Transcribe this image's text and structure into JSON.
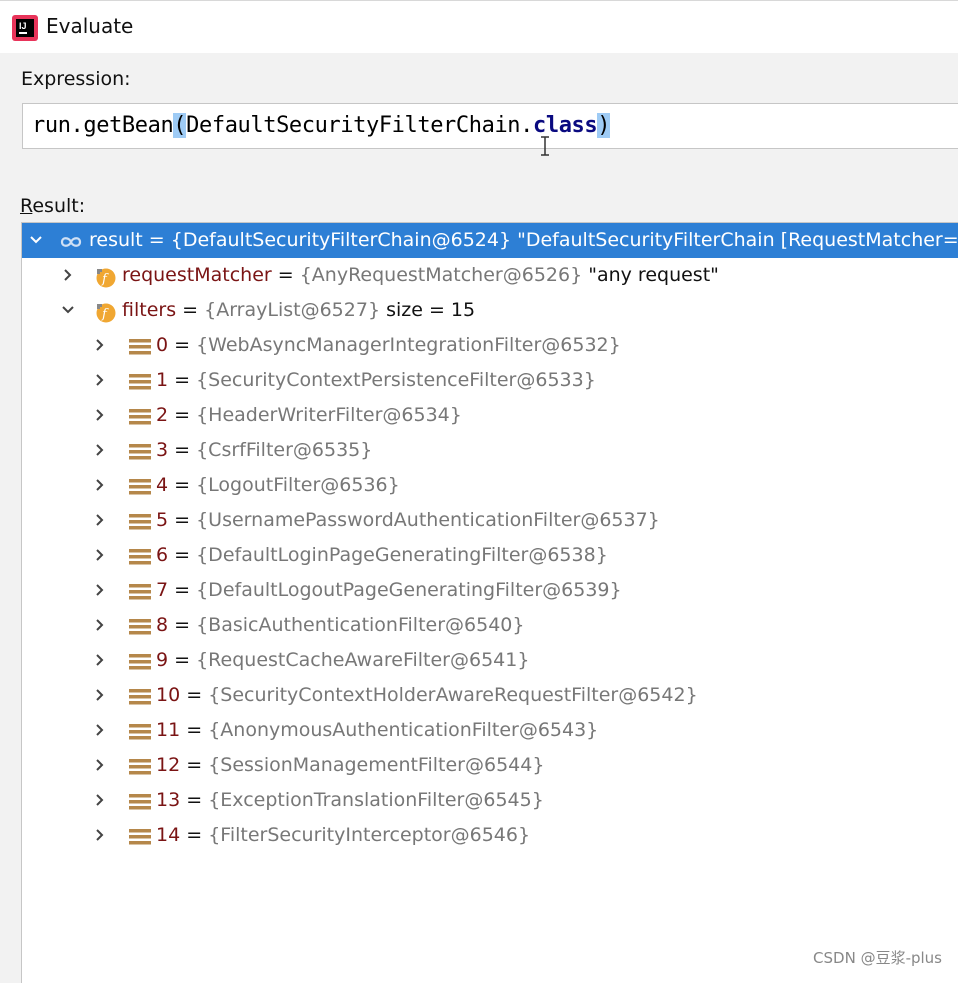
{
  "window": {
    "title": "Evaluate"
  },
  "expression": {
    "label": "Expression:",
    "code_before": "run.getBean",
    "open_paren": "(",
    "class_name": "DefaultSecurityFilterChain",
    "dot": ".",
    "keyword": "class",
    "close_paren": ")"
  },
  "result": {
    "label_u": "R",
    "label_rest": "esult:",
    "root": {
      "name": "result",
      "eq": " = ",
      "ref": "{DefaultSecurityFilterChain@6524}",
      "value": " \"DefaultSecurityFilterChain [RequestMatcher=a"
    },
    "fields": [
      {
        "name": "requestMatcher",
        "eq": " = ",
        "ref": "{AnyRequestMatcher@6526}",
        "value": " \"any request\""
      },
      {
        "name": "filters",
        "eq": " = ",
        "ref": "{ArrayList@6527}",
        "value": "  size = 15"
      }
    ],
    "items": [
      {
        "index": "0",
        "eq": " = ",
        "ref": "{WebAsyncManagerIntegrationFilter@6532}"
      },
      {
        "index": "1",
        "eq": " = ",
        "ref": "{SecurityContextPersistenceFilter@6533}"
      },
      {
        "index": "2",
        "eq": " = ",
        "ref": "{HeaderWriterFilter@6534}"
      },
      {
        "index": "3",
        "eq": " = ",
        "ref": "{CsrfFilter@6535}"
      },
      {
        "index": "4",
        "eq": " = ",
        "ref": "{LogoutFilter@6536}"
      },
      {
        "index": "5",
        "eq": " = ",
        "ref": "{UsernamePasswordAuthenticationFilter@6537}"
      },
      {
        "index": "6",
        "eq": " = ",
        "ref": "{DefaultLoginPageGeneratingFilter@6538}"
      },
      {
        "index": "7",
        "eq": " = ",
        "ref": "{DefaultLogoutPageGeneratingFilter@6539}"
      },
      {
        "index": "8",
        "eq": " = ",
        "ref": "{BasicAuthenticationFilter@6540}"
      },
      {
        "index": "9",
        "eq": " = ",
        "ref": "{RequestCacheAwareFilter@6541}"
      },
      {
        "index": "10",
        "eq": " = ",
        "ref": "{SecurityContextHolderAwareRequestFilter@6542}"
      },
      {
        "index": "11",
        "eq": " = ",
        "ref": "{AnonymousAuthenticationFilter@6543}"
      },
      {
        "index": "12",
        "eq": " = ",
        "ref": "{SessionManagementFilter@6544}"
      },
      {
        "index": "13",
        "eq": " = ",
        "ref": "{ExceptionTranslationFilter@6545}"
      },
      {
        "index": "14",
        "eq": " = ",
        "ref": "{FilterSecurityInterceptor@6546}"
      }
    ]
  },
  "watermark": "CSDN @豆浆-plus",
  "icons": {
    "app": "intellij-logo-icon",
    "root": "object-infinity-icon",
    "field": "field-f-icon",
    "item": "array-element-icon",
    "expand": "chevron-right-icon",
    "collapse": "chevron-down-icon"
  },
  "colors": {
    "selection": "#2d7fd5",
    "field_name": "#7a1414",
    "reference": "#777777",
    "paren_highlight": "#9ecbf5",
    "field_icon": "#f0a732",
    "item_icon": "#b5874a"
  }
}
